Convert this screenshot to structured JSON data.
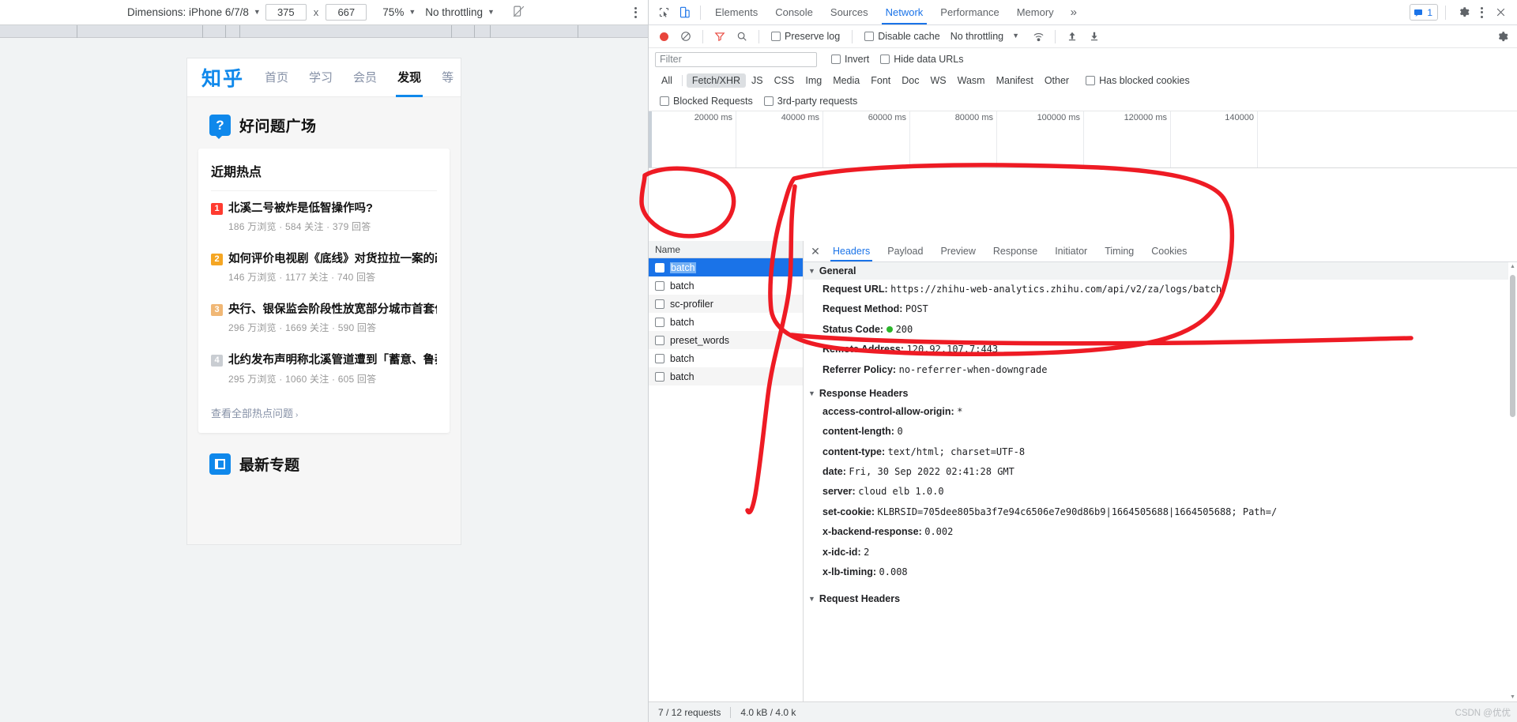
{
  "device_toolbar": {
    "dimensions_label": "Dimensions: iPhone 6/7/8",
    "width_value": "375",
    "height_value": "667",
    "times_symbol": "x",
    "zoom_label": "75%",
    "throttling_label": "No throttling",
    "rotate_icon": "rotate-icon",
    "menu_icon": "kebab-menu-icon"
  },
  "phone": {
    "logo": "知乎",
    "nav": [
      {
        "label": "首页",
        "active": false
      },
      {
        "label": "学习",
        "active": false
      },
      {
        "label": "会员",
        "active": false
      },
      {
        "label": "发现",
        "active": true
      },
      {
        "label": "等",
        "active": false
      }
    ],
    "page_title": "好问题广场",
    "page_title_icon": "question-badge-icon",
    "card": {
      "heading": "近期热点",
      "items": [
        {
          "rank": "1",
          "title": "北溪二号被炸是低智操作吗?",
          "meta": "186 万浏览 · 584 关注 · 379 回答"
        },
        {
          "rank": "2",
          "title": "如何评价电视剧《底线》对货拉拉一案的改编?",
          "meta": "146 万浏览 · 1177 关注 · 740 回答"
        },
        {
          "rank": "3",
          "title": "央行、银保监会阶段性放宽部分城市首套住房贷",
          "meta": "296 万浏览 · 1669 关注 · 590 回答"
        },
        {
          "rank": "4",
          "title": "北约发布声明称北溪管道遭到「蓄意、鲁莽和不",
          "meta": "295 万浏览 · 1060 关注 · 605 回答"
        }
      ],
      "more_label": "查看全部热点问题",
      "more_chevron": "›"
    },
    "section2_title": "最新专题",
    "section2_icon": "document-badge-icon"
  },
  "devtools": {
    "tabs": [
      {
        "label": "Elements",
        "active": false
      },
      {
        "label": "Console",
        "active": false
      },
      {
        "label": "Sources",
        "active": false
      },
      {
        "label": "Network",
        "active": true
      },
      {
        "label": "Performance",
        "active": false
      },
      {
        "label": "Memory",
        "active": false
      }
    ],
    "overflow_label": "»",
    "inspect_icon": "inspect-cursor-icon",
    "device_icon": "device-toggle-icon",
    "message_count": "1",
    "message_icon": "message-icon",
    "settings_icon": "gear-icon",
    "menu_icon": "kebab-menu-icon",
    "close_icon": "close-icon",
    "network_bar": {
      "record_icon": "record-stop-icon",
      "clear_icon": "clear-icon",
      "filter_icon": "funnel-icon",
      "search_icon": "search-icon",
      "preserve_log": "Preserve log",
      "disable_cache": "Disable cache",
      "throttling": "No throttling",
      "wifi_icon": "network-conditions-icon",
      "import_icon": "upload-har-icon",
      "export_icon": "download-har-icon",
      "settings_icon": "gear-icon"
    },
    "filter_bar": {
      "placeholder": "Filter",
      "value": "",
      "invert": "Invert",
      "hide_data_urls": "Hide data URLs"
    },
    "type_filters": [
      {
        "label": "All",
        "active": false
      },
      {
        "label": "Fetch/XHR",
        "active": true
      },
      {
        "label": "JS",
        "active": false
      },
      {
        "label": "CSS",
        "active": false
      },
      {
        "label": "Img",
        "active": false
      },
      {
        "label": "Media",
        "active": false
      },
      {
        "label": "Font",
        "active": false
      },
      {
        "label": "Doc",
        "active": false
      },
      {
        "label": "WS",
        "active": false
      },
      {
        "label": "Wasm",
        "active": false
      },
      {
        "label": "Manifest",
        "active": false
      },
      {
        "label": "Other",
        "active": false
      }
    ],
    "has_blocked_cookies": "Has blocked cookies",
    "blocked_requests": "Blocked Requests",
    "third_party_requests": "3rd-party requests",
    "overview_ticks": [
      "20000 ms",
      "40000 ms",
      "60000 ms",
      "80000 ms",
      "100000 ms",
      "120000 ms",
      "140000"
    ],
    "request_list": {
      "column_header": "Name",
      "rows": [
        {
          "name": "batch",
          "selected": true
        },
        {
          "name": "batch",
          "selected": false
        },
        {
          "name": "sc-profiler",
          "selected": false
        },
        {
          "name": "batch",
          "selected": false
        },
        {
          "name": "preset_words",
          "selected": false
        },
        {
          "name": "batch",
          "selected": false
        },
        {
          "name": "batch",
          "selected": false
        }
      ]
    },
    "detail_tabs": [
      {
        "label": "Headers",
        "active": true
      },
      {
        "label": "Payload",
        "active": false
      },
      {
        "label": "Preview",
        "active": false
      },
      {
        "label": "Response",
        "active": false
      },
      {
        "label": "Initiator",
        "active": false
      },
      {
        "label": "Timing",
        "active": false
      },
      {
        "label": "Cookies",
        "active": false
      }
    ],
    "general_section": {
      "title": "General",
      "request_url_key": "Request URL:",
      "request_url_value": "https://zhihu-web-analytics.zhihu.com/api/v2/za/logs/batch",
      "request_method_key": "Request Method:",
      "request_method_value": "POST",
      "status_code_key": "Status Code:",
      "status_code_value": "200",
      "remote_address_key": "Remote Address:",
      "remote_address_value": "120.92.107.7:443",
      "referrer_policy_key": "Referrer Policy:",
      "referrer_policy_value": "no-referrer-when-downgrade"
    },
    "response_headers": {
      "title": "Response Headers",
      "rows": [
        {
          "key": "access-control-allow-origin:",
          "value": "*"
        },
        {
          "key": "content-length:",
          "value": "0"
        },
        {
          "key": "content-type:",
          "value": "text/html; charset=UTF-8"
        },
        {
          "key": "date:",
          "value": "Fri, 30 Sep 2022 02:41:28 GMT"
        },
        {
          "key": "server:",
          "value": "cloud elb 1.0.0"
        },
        {
          "key": "set-cookie:",
          "value": "KLBRSID=705dee805ba3f7e94c6506e7e90d86b9|1664505688|1664505688; Path=/"
        },
        {
          "key": "x-backend-response:",
          "value": "0.002"
        },
        {
          "key": "x-idc-id:",
          "value": "2"
        },
        {
          "key": "x-lb-timing:",
          "value": "0.008"
        }
      ]
    },
    "request_headers_title": "Request Headers",
    "status_bar": {
      "requests": "7 / 12 requests",
      "transferred": "4.0 kB / 4.0 k"
    }
  },
  "watermark": "CSDN @优优"
}
